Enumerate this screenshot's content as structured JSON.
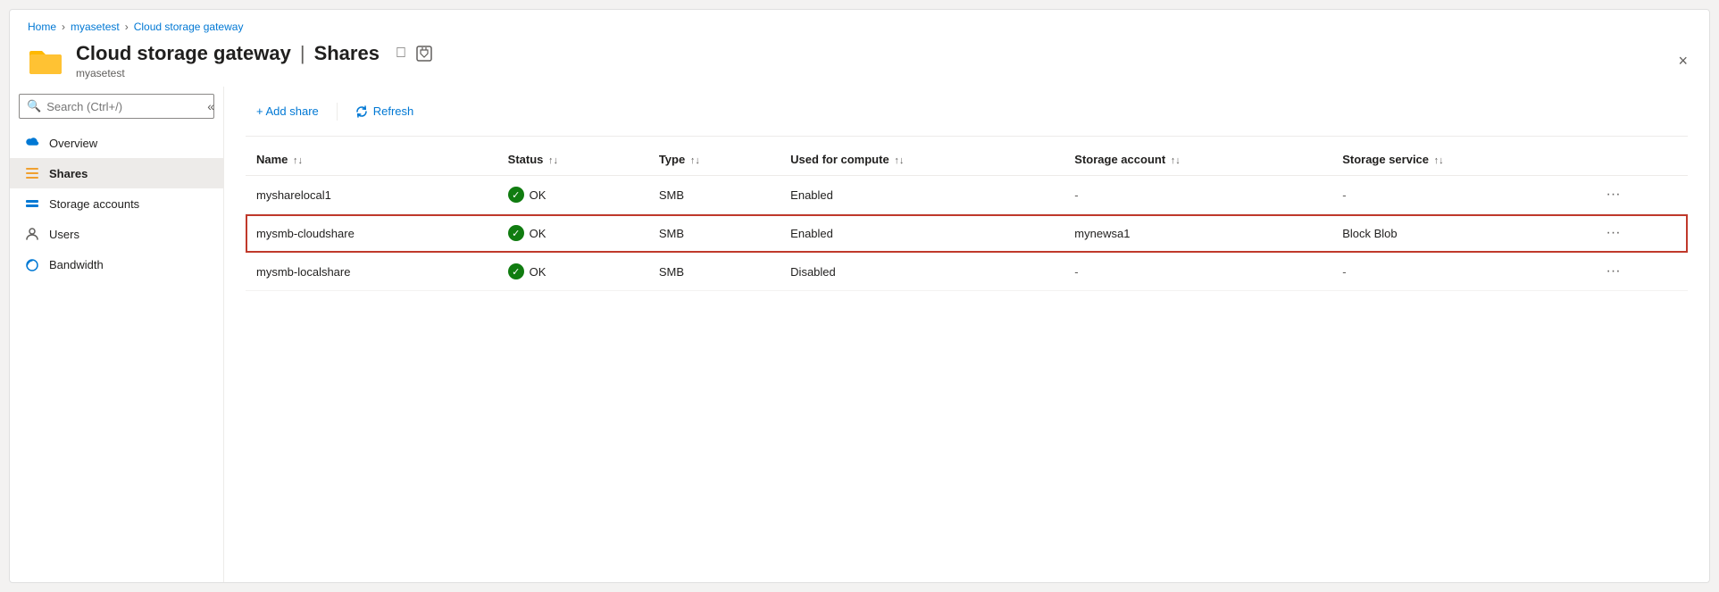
{
  "breadcrumb": {
    "items": [
      "Home",
      "myasetest",
      "Cloud storage gateway"
    ],
    "separators": [
      ">",
      ">"
    ]
  },
  "header": {
    "title": "Cloud storage gateway",
    "separator": "|",
    "section": "Shares",
    "subtitle": "myasetest",
    "pin_label": "pin",
    "close_label": "×"
  },
  "search": {
    "placeholder": "Search (Ctrl+/)"
  },
  "sidebar": {
    "items": [
      {
        "label": "Overview",
        "icon": "cloud-icon"
      },
      {
        "label": "Shares",
        "icon": "shares-icon",
        "active": true
      },
      {
        "label": "Storage accounts",
        "icon": "storage-icon"
      },
      {
        "label": "Users",
        "icon": "users-icon"
      },
      {
        "label": "Bandwidth",
        "icon": "bandwidth-icon"
      }
    ]
  },
  "toolbar": {
    "add_label": "+ Add share",
    "refresh_label": "Refresh"
  },
  "table": {
    "columns": [
      {
        "label": "Name",
        "sort": "↑↓"
      },
      {
        "label": "Status",
        "sort": "↑↓"
      },
      {
        "label": "Type",
        "sort": "↑↓"
      },
      {
        "label": "Used for compute",
        "sort": "↑↓"
      },
      {
        "label": "Storage account",
        "sort": "↑↓"
      },
      {
        "label": "Storage service",
        "sort": "↑↓"
      },
      {
        "label": "",
        "sort": ""
      }
    ],
    "rows": [
      {
        "name": "mysharelocal1",
        "status": "OK",
        "type": "SMB",
        "compute": "Enabled",
        "storage_account": "-",
        "storage_service": "-",
        "selected": false
      },
      {
        "name": "mysmb-cloudshare",
        "status": "OK",
        "type": "SMB",
        "compute": "Enabled",
        "storage_account": "mynewsa1",
        "storage_service": "Block Blob",
        "selected": true
      },
      {
        "name": "mysmb-localshare",
        "status": "OK",
        "type": "SMB",
        "compute": "Disabled",
        "storage_account": "-",
        "storage_service": "-",
        "selected": false
      }
    ]
  }
}
